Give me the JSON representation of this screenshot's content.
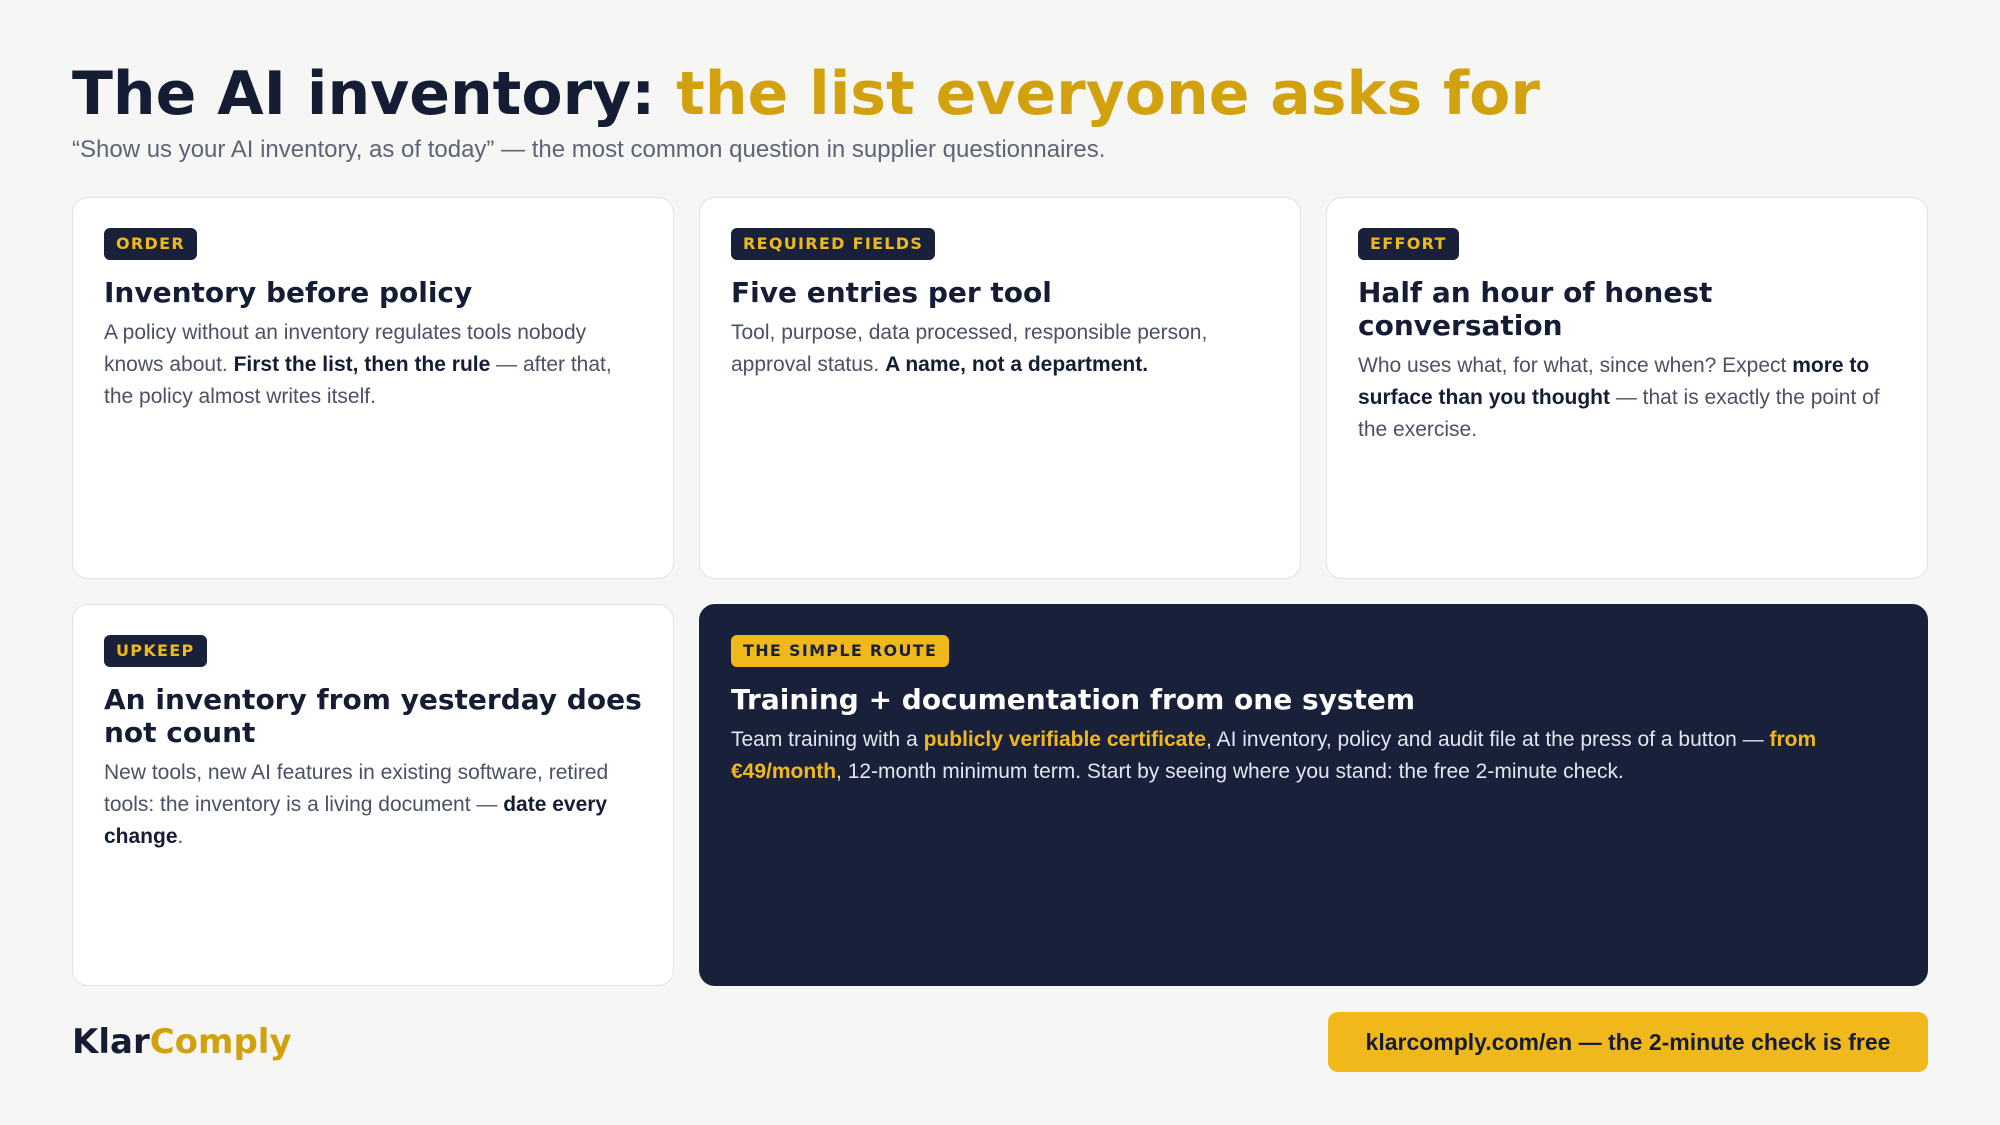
{
  "header": {
    "title_main": "The AI inventory: ",
    "title_accent": "the list everyone asks for",
    "subtitle": "“Show us your AI inventory, as of today” — the most common question in supplier questionnaires."
  },
  "cards": [
    {
      "badge": "ORDER",
      "title": "Inventory before policy",
      "body": [
        {
          "text": "A policy without an inventory regulates tools nobody knows about. ",
          "bold": false
        },
        {
          "text": "First the list, then the rule",
          "bold": true
        },
        {
          "text": " — after that, the policy almost writes itself.",
          "bold": false
        }
      ]
    },
    {
      "badge": "REQUIRED FIELDS",
      "title": "Five entries per tool",
      "body": [
        {
          "text": "Tool, purpose, data processed, responsible person, approval status. ",
          "bold": false
        },
        {
          "text": "A name, not a department.",
          "bold": true
        }
      ]
    },
    {
      "badge": "EFFORT",
      "title": "Half an hour of honest conversation",
      "body": [
        {
          "text": "Who uses what, for what, since when? Expect ",
          "bold": false
        },
        {
          "text": "more to surface than you thought",
          "bold": true
        },
        {
          "text": " — that is exactly the point of the exercise.",
          "bold": false
        }
      ]
    },
    {
      "badge": "UPKEEP",
      "title": "An inventory from yesterday does not count",
      "body": [
        {
          "text": "New tools, new AI features in existing software, retired tools: the inventory is a living document — ",
          "bold": false
        },
        {
          "text": "date every change",
          "bold": true
        },
        {
          "text": ".",
          "bold": false
        }
      ]
    },
    {
      "badge": "THE SIMPLE ROUTE",
      "title": "Training + documentation from one system",
      "body": [
        {
          "text": "Team training with a ",
          "bold": false
        },
        {
          "text": "publicly verifiable certificate",
          "bold": true
        },
        {
          "text": ", AI inventory, policy and audit file at the press of a button — ",
          "bold": false
        },
        {
          "text": "from €49/month",
          "bold": true
        },
        {
          "text": ", 12-month minimum term. Start by seeing where you stand: the free 2-minute check.",
          "bold": false
        }
      ]
    }
  ],
  "footer": {
    "logo_part1": "Klar",
    "logo_part2": "Comply",
    "cta_label": "klarcomply.com/en — the 2-minute check is free"
  },
  "colors": {
    "navy": "#19213a",
    "accent_gold": "#d2a20e",
    "badge_yellow": "#f1b81c",
    "background": "#f6f6f4"
  }
}
